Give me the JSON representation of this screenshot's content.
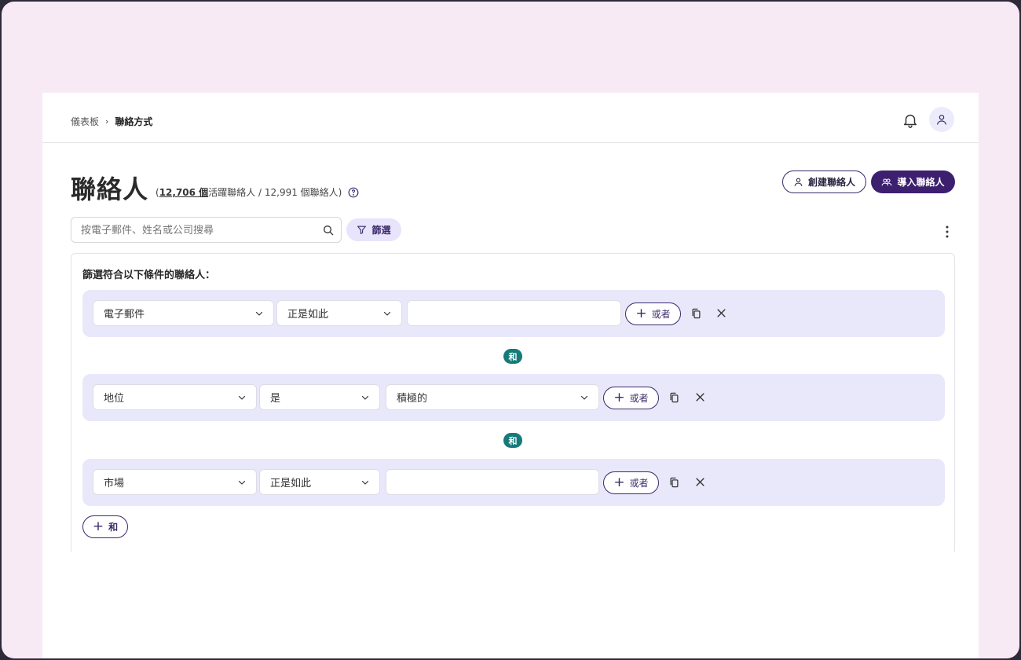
{
  "breadcrumb": {
    "home": "儀表板",
    "separator": "›",
    "current": "聯絡方式"
  },
  "header": {
    "title": "聯絡人",
    "counts": {
      "open": "(",
      "active_number": "12,706 個",
      "active_label": "活躍聯絡人 / 12,991 個聯絡人",
      "close": ")"
    },
    "create_label": "創建聯絡人",
    "import_label": "導入聯絡人"
  },
  "search": {
    "placeholder": "按電子郵件、姓名或公司搜尋",
    "value": ""
  },
  "filter_button": "篩選",
  "filter_panel": {
    "heading": "篩選符合以下條件的聯絡人：",
    "rows": [
      {
        "field": "電子郵件",
        "operator": "正是如此",
        "value_type": "text",
        "value": ""
      },
      {
        "field": "地位",
        "operator": "是",
        "value_type": "select",
        "value": "積極的"
      },
      {
        "field": "市場",
        "operator": "正是如此",
        "value_type": "text",
        "value": ""
      }
    ],
    "or_label": "或者",
    "and_label": "和",
    "add_and_label": "和"
  },
  "colors": {
    "accent": "#3c1f6e",
    "row_bg": "#e9e8fb",
    "and_badge": "#167a78",
    "frame_bg": "#f7eaf5"
  }
}
